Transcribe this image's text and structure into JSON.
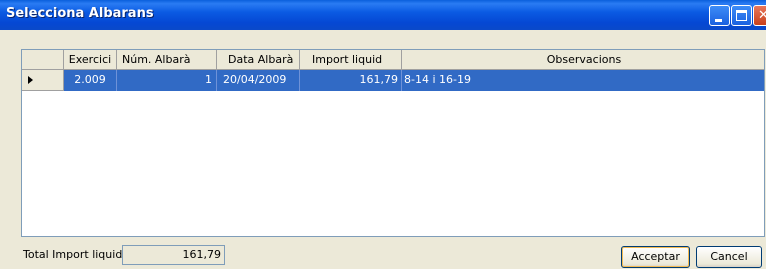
{
  "window": {
    "title": "Selecciona Albarans"
  },
  "grid": {
    "columns": [
      "Exercici",
      "Núm. Albarà",
      "Data Albarà",
      "Import liquid",
      "Observacions"
    ],
    "rows": [
      {
        "exercici": "2.009",
        "num_albara": "1",
        "data_albara": "20/04/2009",
        "import_liquid": "161,79",
        "observacions": "8-14 i 16-19"
      }
    ]
  },
  "footer": {
    "total_label": "Total Import liquid:",
    "total_value": "161,79",
    "accept_label": "Acceptar",
    "cancel_label": "Cancel"
  },
  "colors": {
    "titlebar": "#0b5be3",
    "selection": "#316ac5",
    "window_bg": "#ece9d8"
  }
}
